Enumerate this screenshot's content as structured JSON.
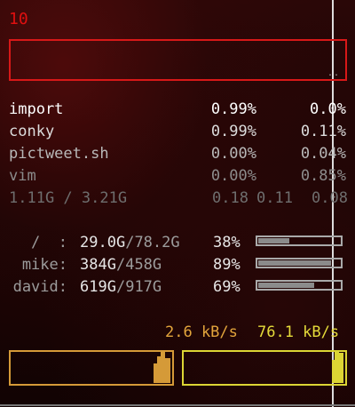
{
  "cpu": {
    "count": "10",
    "graph_dots": ".."
  },
  "processes": [
    {
      "name": "import",
      "cpu": "0.99%",
      "mem": "0.0%"
    },
    {
      "name": "conky",
      "cpu": "0.99%",
      "mem": "0.11%"
    },
    {
      "name": "pictweet.sh",
      "cpu": "0.00%",
      "mem": "0.04%"
    },
    {
      "name": "vim",
      "cpu": "0.00%",
      "mem": "0.85%"
    }
  ],
  "memory": {
    "summary": "1.11G / 3.21G",
    "load": [
      "0.18",
      "0.11",
      "0.08"
    ]
  },
  "filesystems": [
    {
      "label": "/  :",
      "used": "29.0G",
      "total": "78.2G",
      "percent": "38%",
      "fill": 0.38
    },
    {
      "label": "mike:",
      "used": "384G",
      "total": "458G",
      "percent": "89%",
      "fill": 0.89
    },
    {
      "label": "david:",
      "used": "619G",
      "total": "917G",
      "percent": "69%",
      "fill": 0.69
    }
  ],
  "network": {
    "down_rate": "2.6 kB/s",
    "up_rate": "76.1 kB/s",
    "colors": {
      "down": "#d59a38",
      "up": "#dcd534"
    }
  },
  "colors": {
    "accent_red": "#d81818",
    "bar_fill": "#8b8b8b",
    "bar_border": "#a9a9a9"
  }
}
